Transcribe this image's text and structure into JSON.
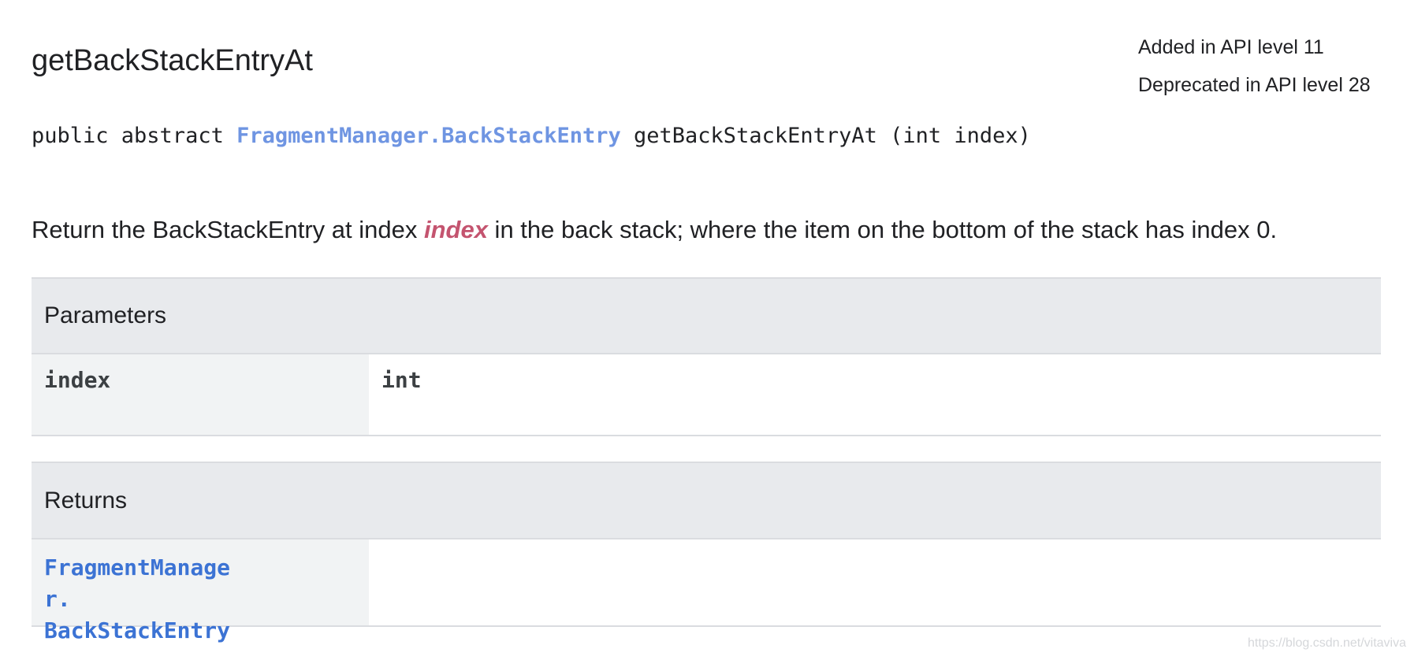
{
  "method": {
    "title": "getBackStackEntryAt",
    "added": "Added in API level 11",
    "deprecated": "Deprecated in API level 28"
  },
  "signature": {
    "prefix": "public abstract ",
    "return_type": "FragmentManager.BackStackEntry",
    "suffix": " getBackStackEntryAt (int index)"
  },
  "description": {
    "before": "Return the BackStackEntry at index ",
    "param": "index",
    "after": " in the back stack; where the item on the bottom of the stack has index 0."
  },
  "parameters": {
    "header": "Parameters",
    "rows": [
      {
        "name": "index",
        "type": "int"
      }
    ]
  },
  "returns": {
    "header": "Returns",
    "type_part1": "FragmentManager.",
    "type_part2": "BackStackEntry",
    "description": ""
  },
  "watermark": "https://blog.csdn.net/vitaviva",
  "colors": {
    "link": "#6f95e2",
    "param_highlight": "#c4546f",
    "table_header_bg": "#e8eaed",
    "table_cell_bg": "#f1f3f4"
  }
}
